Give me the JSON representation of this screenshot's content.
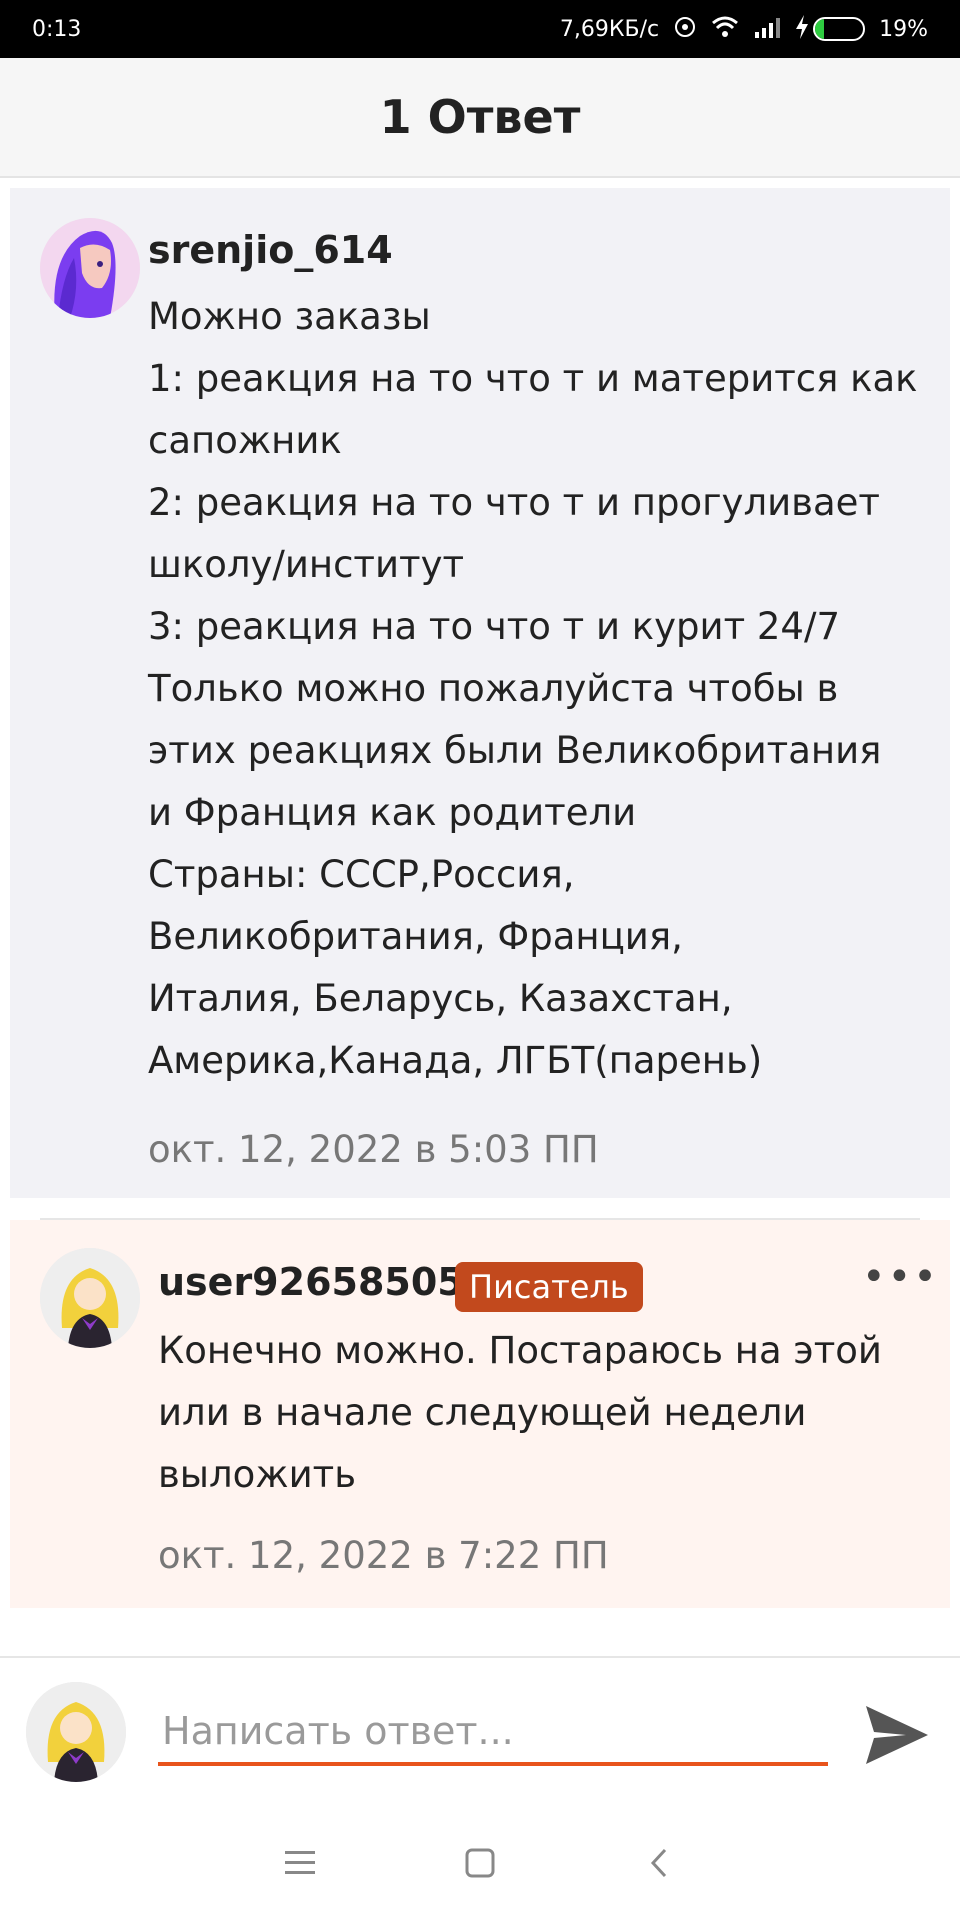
{
  "status_bar": {
    "time": "0:13",
    "network_speed": "7,69КБ/с",
    "battery_percent": "19%",
    "battery_level": 0.19,
    "icons": [
      "cast-icon",
      "wifi-icon",
      "signal-icon",
      "charging-icon",
      "battery-icon"
    ]
  },
  "header": {
    "title": "1 Ответ"
  },
  "parent_comment": {
    "username": "srenjio_614",
    "text": "Можно заказы\n1: реакция на то что т и матерится как\nсапожник\n2: реакция на то что т и прогуливает\nшколу/институт\n3: реакция на то что т и курит 24/7\nТолько можно пожалуйста чтобы в\nэтих реакциях были Великобритания\nи Франция как родители\nСтраны: СССР,Россия,\nВеликобритания, Франция,\nИталия, Беларусь, Казахстан,\nАмерика,Канада, ЛГБТ(парень)",
    "timestamp": "окт. 12, 2022 в 5:03 ПП"
  },
  "reply_comment": {
    "username": "user92658505",
    "badge": "Писатель",
    "text": "Конечно можно. Постараюсь на этой\nили в начале следующей недели\nвыложить",
    "timestamp": "окт. 12, 2022 в 7:22 ПП",
    "more_label": "•••"
  },
  "reply_bar": {
    "placeholder": "Написать ответ..."
  },
  "colors": {
    "accent": "#e8541c",
    "badge": "#c2491d",
    "parent_bg": "#f2f2f6",
    "reply_bg": "#fff4f0"
  }
}
